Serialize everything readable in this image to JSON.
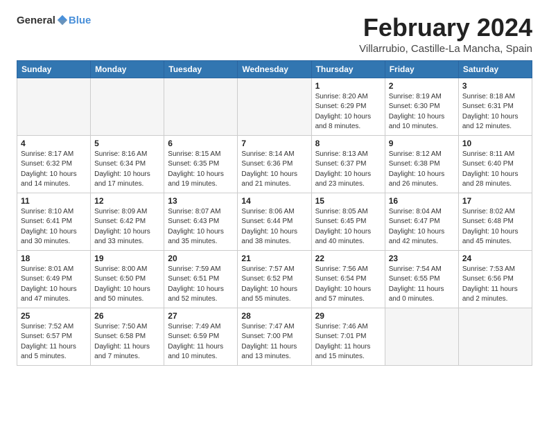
{
  "logo": {
    "text_general": "General",
    "text_blue": "Blue"
  },
  "title": "February 2024",
  "subtitle": "Villarrubio, Castille-La Mancha, Spain",
  "columns": [
    "Sunday",
    "Monday",
    "Tuesday",
    "Wednesday",
    "Thursday",
    "Friday",
    "Saturday"
  ],
  "weeks": [
    [
      {
        "day": "",
        "info": ""
      },
      {
        "day": "",
        "info": ""
      },
      {
        "day": "",
        "info": ""
      },
      {
        "day": "",
        "info": ""
      },
      {
        "day": "1",
        "info": "Sunrise: 8:20 AM\nSunset: 6:29 PM\nDaylight: 10 hours\nand 8 minutes."
      },
      {
        "day": "2",
        "info": "Sunrise: 8:19 AM\nSunset: 6:30 PM\nDaylight: 10 hours\nand 10 minutes."
      },
      {
        "day": "3",
        "info": "Sunrise: 8:18 AM\nSunset: 6:31 PM\nDaylight: 10 hours\nand 12 minutes."
      }
    ],
    [
      {
        "day": "4",
        "info": "Sunrise: 8:17 AM\nSunset: 6:32 PM\nDaylight: 10 hours\nand 14 minutes."
      },
      {
        "day": "5",
        "info": "Sunrise: 8:16 AM\nSunset: 6:34 PM\nDaylight: 10 hours\nand 17 minutes."
      },
      {
        "day": "6",
        "info": "Sunrise: 8:15 AM\nSunset: 6:35 PM\nDaylight: 10 hours\nand 19 minutes."
      },
      {
        "day": "7",
        "info": "Sunrise: 8:14 AM\nSunset: 6:36 PM\nDaylight: 10 hours\nand 21 minutes."
      },
      {
        "day": "8",
        "info": "Sunrise: 8:13 AM\nSunset: 6:37 PM\nDaylight: 10 hours\nand 23 minutes."
      },
      {
        "day": "9",
        "info": "Sunrise: 8:12 AM\nSunset: 6:38 PM\nDaylight: 10 hours\nand 26 minutes."
      },
      {
        "day": "10",
        "info": "Sunrise: 8:11 AM\nSunset: 6:40 PM\nDaylight: 10 hours\nand 28 minutes."
      }
    ],
    [
      {
        "day": "11",
        "info": "Sunrise: 8:10 AM\nSunset: 6:41 PM\nDaylight: 10 hours\nand 30 minutes."
      },
      {
        "day": "12",
        "info": "Sunrise: 8:09 AM\nSunset: 6:42 PM\nDaylight: 10 hours\nand 33 minutes."
      },
      {
        "day": "13",
        "info": "Sunrise: 8:07 AM\nSunset: 6:43 PM\nDaylight: 10 hours\nand 35 minutes."
      },
      {
        "day": "14",
        "info": "Sunrise: 8:06 AM\nSunset: 6:44 PM\nDaylight: 10 hours\nand 38 minutes."
      },
      {
        "day": "15",
        "info": "Sunrise: 8:05 AM\nSunset: 6:45 PM\nDaylight: 10 hours\nand 40 minutes."
      },
      {
        "day": "16",
        "info": "Sunrise: 8:04 AM\nSunset: 6:47 PM\nDaylight: 10 hours\nand 42 minutes."
      },
      {
        "day": "17",
        "info": "Sunrise: 8:02 AM\nSunset: 6:48 PM\nDaylight: 10 hours\nand 45 minutes."
      }
    ],
    [
      {
        "day": "18",
        "info": "Sunrise: 8:01 AM\nSunset: 6:49 PM\nDaylight: 10 hours\nand 47 minutes."
      },
      {
        "day": "19",
        "info": "Sunrise: 8:00 AM\nSunset: 6:50 PM\nDaylight: 10 hours\nand 50 minutes."
      },
      {
        "day": "20",
        "info": "Sunrise: 7:59 AM\nSunset: 6:51 PM\nDaylight: 10 hours\nand 52 minutes."
      },
      {
        "day": "21",
        "info": "Sunrise: 7:57 AM\nSunset: 6:52 PM\nDaylight: 10 hours\nand 55 minutes."
      },
      {
        "day": "22",
        "info": "Sunrise: 7:56 AM\nSunset: 6:54 PM\nDaylight: 10 hours\nand 57 minutes."
      },
      {
        "day": "23",
        "info": "Sunrise: 7:54 AM\nSunset: 6:55 PM\nDaylight: 11 hours\nand 0 minutes."
      },
      {
        "day": "24",
        "info": "Sunrise: 7:53 AM\nSunset: 6:56 PM\nDaylight: 11 hours\nand 2 minutes."
      }
    ],
    [
      {
        "day": "25",
        "info": "Sunrise: 7:52 AM\nSunset: 6:57 PM\nDaylight: 11 hours\nand 5 minutes."
      },
      {
        "day": "26",
        "info": "Sunrise: 7:50 AM\nSunset: 6:58 PM\nDaylight: 11 hours\nand 7 minutes."
      },
      {
        "day": "27",
        "info": "Sunrise: 7:49 AM\nSunset: 6:59 PM\nDaylight: 11 hours\nand 10 minutes."
      },
      {
        "day": "28",
        "info": "Sunrise: 7:47 AM\nSunset: 7:00 PM\nDaylight: 11 hours\nand 13 minutes."
      },
      {
        "day": "29",
        "info": "Sunrise: 7:46 AM\nSunset: 7:01 PM\nDaylight: 11 hours\nand 15 minutes."
      },
      {
        "day": "",
        "info": ""
      },
      {
        "day": "",
        "info": ""
      }
    ]
  ]
}
